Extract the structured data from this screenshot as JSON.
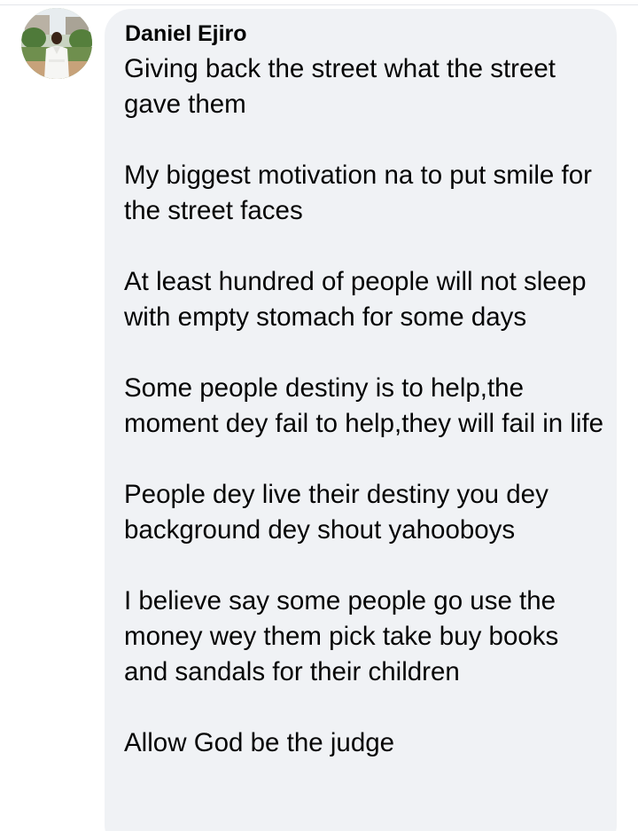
{
  "comment": {
    "author": "Daniel Ejiro",
    "paragraphs": [
      "Giving back the street what the street gave them",
      "My biggest motivation na to put smile for the street faces",
      "At least hundred of people will not sleep with empty stomach for some days",
      "Some people destiny is to help,the moment dey fail to help,they will fail in life",
      "People dey live their destiny you dey background dey shout yahooboys",
      "I believe say some people go use the money wey them pick take buy books and sandals for their children",
      "Allow God be the judge"
    ]
  }
}
